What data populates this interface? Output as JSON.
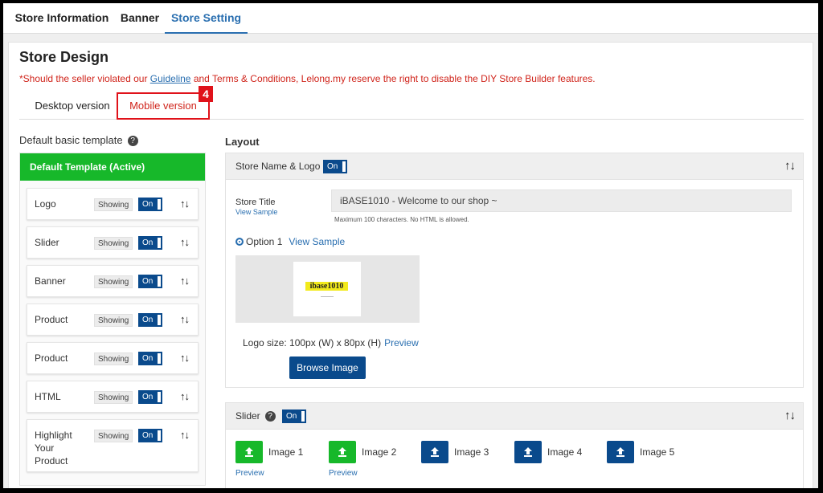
{
  "top_tabs": [
    "Store Information",
    "Banner",
    "Store Setting"
  ],
  "page_title": "Store Design",
  "warning": {
    "prefix": "*Should the seller violated our ",
    "link": "Guideline",
    "suffix": " and Terms & Conditions, Lelong.my reserve the right to disable the DIY Store Builder features."
  },
  "version_tabs": [
    "Desktop version",
    "Mobile version"
  ],
  "callout_number": "4",
  "left": {
    "heading": "Default basic template",
    "help_icon": "?",
    "active_template": "Default Template (Active)",
    "modules": [
      {
        "name": "Logo",
        "status": "Showing",
        "toggle": "On"
      },
      {
        "name": "Slider",
        "status": "Showing",
        "toggle": "On"
      },
      {
        "name": "Banner",
        "status": "Showing",
        "toggle": "On"
      },
      {
        "name": "Product",
        "status": "Showing",
        "toggle": "On"
      },
      {
        "name": "Product",
        "status": "Showing",
        "toggle": "On"
      },
      {
        "name": "HTML",
        "status": "Showing",
        "toggle": "On"
      },
      {
        "name": "Highlight Your Product",
        "status": "Showing",
        "toggle": "On"
      }
    ],
    "sort_icon": "↑↓"
  },
  "layout": {
    "heading": "Layout",
    "store_name_logo": {
      "label": "Store Name & Logo",
      "toggle": "On",
      "store_title_label": "Store Title",
      "view_sample": "View Sample",
      "store_title_value": "iBASE1010 - Welcome to our shop ~",
      "hint": "Maximum 100 characters. No HTML is allowed.",
      "option_label": "Option 1",
      "option_link": "View Sample",
      "logo_text": "ibase1010",
      "logo_size": "Logo size: 100px (W) x 80px (H)",
      "preview": "Preview",
      "browse": "Browse Image"
    },
    "slider": {
      "label": "Slider",
      "toggle": "On",
      "images": [
        {
          "label": "Image 1",
          "color": "green",
          "preview": "Preview"
        },
        {
          "label": "Image 2",
          "color": "green",
          "preview": "Preview"
        },
        {
          "label": "Image 3",
          "color": "blue",
          "preview": ""
        },
        {
          "label": "Image 4",
          "color": "blue",
          "preview": ""
        },
        {
          "label": "Image 5",
          "color": "blue",
          "preview": ""
        }
      ]
    }
  },
  "colors": {
    "accent_blue": "#2a6fb0",
    "toggle_blue": "#0a4a8c",
    "green": "#17b82a",
    "red": "#e0121a"
  }
}
